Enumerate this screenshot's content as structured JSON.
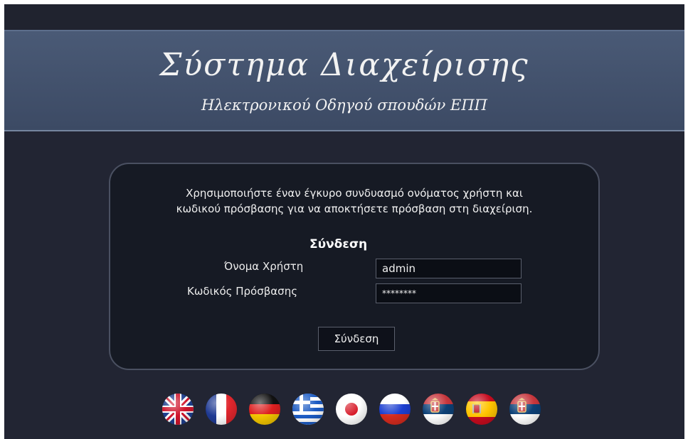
{
  "header": {
    "title": "Σύστημα Διαχείρισης",
    "subtitle": "Ηλεκτρονικού Οδηγού σπουδών ΕΠΠ"
  },
  "login": {
    "instructions_line1": "Χρησιμοποιήστε έναν έγκυρο συνδυασμό ονόματος χρήστη και",
    "instructions_line2": "κωδικού πρόσβασης για να αποκτήσετε πρόσβαση στη διαχείριση.",
    "heading": "Σύνδεση",
    "username_label": "Όνομα Χρήστη",
    "username_value": "admin",
    "password_label": "Κωδικός Πρόσβασης",
    "password_value": "********",
    "submit_label": "Σύνδεση"
  },
  "languages": [
    "uk-flag-icon",
    "france-flag-icon",
    "germany-flag-icon",
    "greece-flag-icon",
    "japan-flag-icon",
    "russia-flag-icon",
    "serbia-flag-icon",
    "spain-flag-icon",
    "serbia-flag-icon"
  ],
  "colors": {
    "background": "#222533",
    "header": "#4a5a76",
    "panel": "#161a24"
  }
}
